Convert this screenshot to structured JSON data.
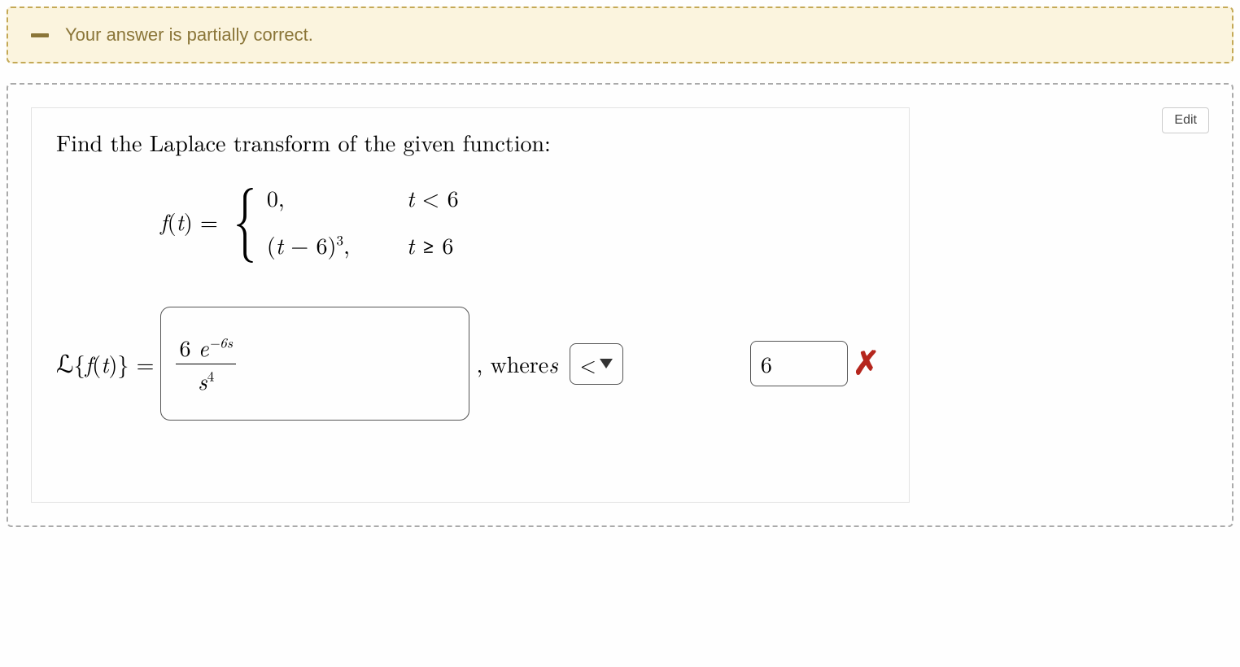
{
  "feedback": {
    "icon": "minus-icon",
    "message": "Your answer is partially correct."
  },
  "question": {
    "prompt": "Find the Laplace transform of the given function:",
    "function_notation": {
      "lhs_prefix": "f",
      "lhs_arg_open": "(",
      "lhs_var": "t",
      "lhs_arg_close": ")",
      "equals": " = "
    },
    "piecewise": {
      "case1_left": "0,",
      "case1_right_prefix": "t",
      "case1_right_rel": " < ",
      "case1_right_val": "6",
      "case2_expr_open": "(",
      "case2_expr_var": "t",
      "case2_expr_op": " − 6",
      "case2_expr_close": ")",
      "case2_expr_power": "3",
      "case2_expr_comma": ",",
      "case2_right_prefix": "t",
      "case2_right_rel": " ≥ ",
      "case2_right_val": "6"
    },
    "answer_line": {
      "operator_L": "ℒ",
      "operator_open": "{",
      "operator_func": "f",
      "operator_arg_open": "(",
      "operator_var": "t",
      "operator_arg_close": ")",
      "operator_close": "}",
      "equals": " = ",
      "where_prefix": ", where ",
      "where_var": "s"
    },
    "input_transform": {
      "numerator_coeff": "6 ",
      "numerator_base": "e",
      "numerator_exp": "−6s",
      "denominator_base": "s",
      "denominator_exp": "4"
    },
    "select_operator": "<",
    "input_value": "6",
    "feedback_icon": "incorrect"
  },
  "controls": {
    "edit_label": "Edit"
  }
}
